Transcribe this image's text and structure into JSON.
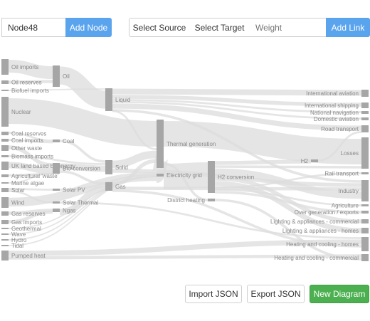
{
  "toolbar": {
    "node_input_value": "Node48",
    "add_node_label": "Add Node",
    "select_source_label": "Select Source",
    "select_target_label": "Select Target",
    "weight_placeholder": "Weight",
    "add_link_label": "Add Link"
  },
  "footer": {
    "import_label": "Import JSON",
    "export_label": "Export JSON",
    "new_diagram_label": "New Diagram"
  },
  "colors": {
    "accent_blue": "#5aa4ee",
    "accent_green": "#4caf50",
    "node": "#a6a6a6",
    "link": "#dcdcdc"
  },
  "diagram": {
    "nodes": [
      {
        "id": "oil_imports",
        "label": "Oil imports"
      },
      {
        "id": "oil_reserves",
        "label": "Oil reserves"
      },
      {
        "id": "biofuel_imports",
        "label": "Biofuel imports"
      },
      {
        "id": "nuclear",
        "label": "Nuclear"
      },
      {
        "id": "coal_reserves",
        "label": "Coal reserves"
      },
      {
        "id": "coal_imports",
        "label": "Coal imports"
      },
      {
        "id": "other_waste",
        "label": "Other waste"
      },
      {
        "id": "biomass_imports",
        "label": "Biomass imports"
      },
      {
        "id": "uk_land",
        "label": "UK land based bioenergy"
      },
      {
        "id": "agri_waste",
        "label": "Agricultural 'waste'"
      },
      {
        "id": "marine_algae",
        "label": "Marine algae"
      },
      {
        "id": "solar",
        "label": "Solar"
      },
      {
        "id": "wind",
        "label": "Wind"
      },
      {
        "id": "gas_reserves",
        "label": "Gas reserves"
      },
      {
        "id": "gas_imports",
        "label": "Gas imports"
      },
      {
        "id": "geothermal",
        "label": "Geothermal"
      },
      {
        "id": "wave",
        "label": "Wave"
      },
      {
        "id": "hydro",
        "label": "Hydro"
      },
      {
        "id": "tidal",
        "label": "Tidal"
      },
      {
        "id": "pumped_heat",
        "label": "Pumped heat"
      },
      {
        "id": "oil",
        "label": "Oil"
      },
      {
        "id": "coal",
        "label": "Coal"
      },
      {
        "id": "bio_conversion",
        "label": "Bio-conversion"
      },
      {
        "id": "solar_pv",
        "label": "Solar PV"
      },
      {
        "id": "solar_thermal",
        "label": "Solar Thermal"
      },
      {
        "id": "ngas",
        "label": "Ngas"
      },
      {
        "id": "liquid",
        "label": "Liquid"
      },
      {
        "id": "solid",
        "label": "Solid"
      },
      {
        "id": "gas",
        "label": "Gas"
      },
      {
        "id": "thermal_generation",
        "label": "Thermal generation"
      },
      {
        "id": "electricity_grid",
        "label": "Electricity grid"
      },
      {
        "id": "district_heating",
        "label": "District heating"
      },
      {
        "id": "h2_conversion",
        "label": "H2 conversion"
      },
      {
        "id": "h2",
        "label": "H2"
      },
      {
        "id": "intl_aviation",
        "label": "International aviation"
      },
      {
        "id": "intl_shipping",
        "label": "International shipping"
      },
      {
        "id": "national_navigation",
        "label": "National navigation"
      },
      {
        "id": "domestic_aviation",
        "label": "Domestic aviation"
      },
      {
        "id": "road_transport",
        "label": "Road transport"
      },
      {
        "id": "losses",
        "label": "Losses"
      },
      {
        "id": "rail_transport",
        "label": "Rail transport"
      },
      {
        "id": "industry",
        "label": "Industry"
      },
      {
        "id": "agriculture",
        "label": "Agriculture"
      },
      {
        "id": "over_generation",
        "label": "Over generation / exports"
      },
      {
        "id": "lighting_commercial",
        "label": "Lighting & appliances - commercial"
      },
      {
        "id": "lighting_homes",
        "label": "Lighting & appliances - homes"
      },
      {
        "id": "heating_homes",
        "label": "Heating and cooling - homes"
      },
      {
        "id": "heating_commercial",
        "label": "Heating and cooling - commercial"
      }
    ]
  }
}
